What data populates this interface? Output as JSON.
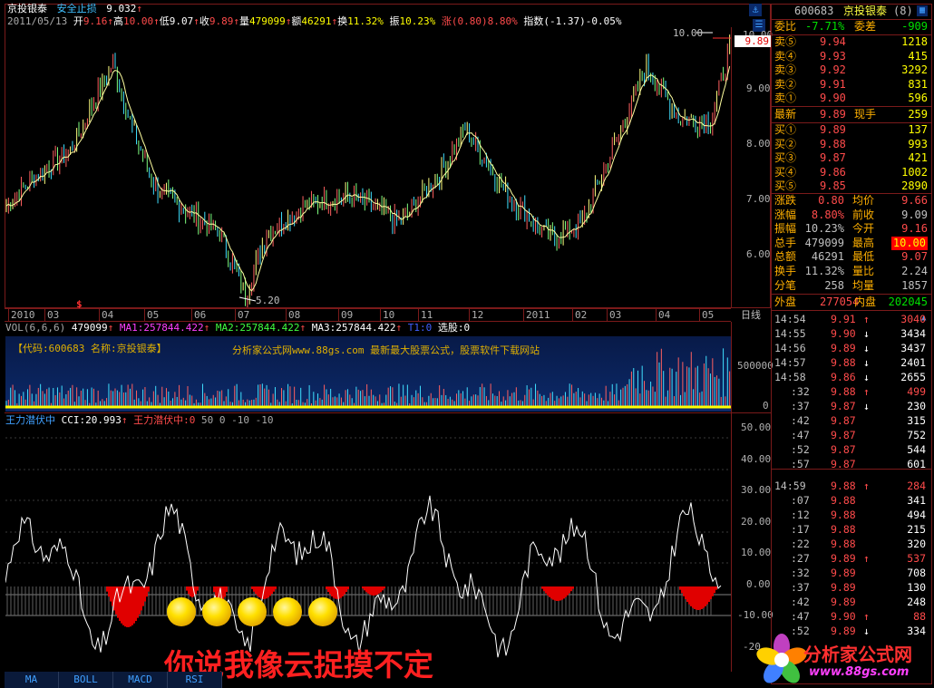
{
  "header": {
    "stock_name": "京投银泰",
    "indicator_name": "安全止损",
    "indicator_value": "9.032",
    "date": "2011/05/13",
    "open_label": "开",
    "open": "9.16",
    "high_label": "高",
    "high": "10.00",
    "low_label": "低",
    "low": "9.07",
    "close_label": "收",
    "close": "9.89",
    "vol_label": "量",
    "volume": "479099",
    "amount_label": "额",
    "amount": "46291",
    "turnover_label": "换",
    "turnover": "11.32%",
    "amplitude_label": "振",
    "amplitude": "10.23%",
    "change_text": "涨(0.80)8.80%",
    "index_text": "指数(-1.37)-0.05%"
  },
  "main_chart": {
    "y_ticks": [
      "10.00",
      "9.00",
      "8.00",
      "7.00",
      "6.00"
    ],
    "high_marker": "10.00",
    "low_marker": "5.20",
    "current_price_tag": "9.89",
    "x_ticks": [
      "2010",
      "03",
      "04",
      "05",
      "06",
      "07",
      "08",
      "09",
      "10",
      "11",
      "12",
      "2011",
      "02",
      "03",
      "04",
      "05"
    ],
    "signal_mark": "$",
    "tab_label": "日线"
  },
  "volume_panel": {
    "params": "VOL(6,6,6)",
    "vol": "479099",
    "ma1": "MA1:257844.422",
    "ma2": "MA2:257844.422",
    "ma3": "MA3:257844.422",
    "t1": "T1:0",
    "pick": "选股:0",
    "banner_code": "【代码:600683 名称:京投银泰】",
    "banner_site": "分析家公式网www.88gs.com 最新最大股票公式，股票软件下载网站",
    "y_ticks": [
      "500000",
      "0"
    ]
  },
  "cci_panel": {
    "name": "王力潜伏中",
    "cci": "CCI:20.993",
    "sub_name": "王力潜伏中:0",
    "levels": "50 0 -10 -10",
    "y_ticks": [
      "50.00",
      "40.00",
      "30.00",
      "20.00",
      "10.00",
      "0.00",
      "-10.00",
      "-20"
    ],
    "caption": "你说我像云捉摸不定"
  },
  "tabs": [
    "MA",
    "BOLL",
    "MACD",
    "RSI"
  ],
  "quote": {
    "code": "600683",
    "name": "京投银泰",
    "badge": "(8)",
    "weibi_label": "委比",
    "weibi": "-7.71%",
    "weicha_label": "委差",
    "weicha": "-909",
    "sells": [
      {
        "label": "卖⑤",
        "price": "9.94",
        "vol": "1218"
      },
      {
        "label": "卖④",
        "price": "9.93",
        "vol": "415"
      },
      {
        "label": "卖③",
        "price": "9.92",
        "vol": "3292"
      },
      {
        "label": "卖②",
        "price": "9.91",
        "vol": "831"
      },
      {
        "label": "卖①",
        "price": "9.90",
        "vol": "596"
      }
    ],
    "latest_label": "最新",
    "latest": "9.89",
    "xianshou_label": "现手",
    "xianshou": "259",
    "buys": [
      {
        "label": "买①",
        "price": "9.89",
        "vol": "137"
      },
      {
        "label": "买②",
        "price": "9.88",
        "vol": "993"
      },
      {
        "label": "买③",
        "price": "9.87",
        "vol": "421"
      },
      {
        "label": "买④",
        "price": "9.86",
        "vol": "1002"
      },
      {
        "label": "买⑤",
        "price": "9.85",
        "vol": "2890"
      }
    ],
    "stats": [
      {
        "l1": "涨跌",
        "v1": "0.80",
        "l2": "均价",
        "v2": "9.66"
      },
      {
        "l1": "涨幅",
        "v1": "8.80%",
        "l2": "前收",
        "v2": "9.09"
      },
      {
        "l1": "振幅",
        "v1": "10.23%",
        "l2": "今开",
        "v2": "9.16"
      },
      {
        "l1": "总手",
        "v1": "479099",
        "l2": "最高",
        "v2": "10.00"
      },
      {
        "l1": "总额",
        "v1": "46291",
        "l2": "最低",
        "v2": "9.07"
      },
      {
        "l1": "换手",
        "v1": "11.32%",
        "l2": "量比",
        "v2": "2.24"
      },
      {
        "l1": "分笔",
        "v1": "258",
        "l2": "均量",
        "v2": "1857"
      }
    ],
    "waipan_label": "外盘",
    "waipan": "277054",
    "neipan_label": "内盘",
    "neipan": "202045"
  },
  "ticks": [
    {
      "t": "14:54",
      "p": "9.91",
      "d": "↑",
      "v": "3040"
    },
    {
      "t": "14:55",
      "p": "9.90",
      "d": "↓",
      "v": "3434"
    },
    {
      "t": "14:56",
      "p": "9.89",
      "d": "↓",
      "v": "3437"
    },
    {
      "t": "14:57",
      "p": "9.88",
      "d": "↓",
      "v": "2401"
    },
    {
      "t": "14:58",
      "p": "9.86",
      "d": "↓",
      "v": "2655"
    },
    {
      "t": ":32",
      "p": "9.88",
      "d": "↑",
      "v": "499"
    },
    {
      "t": ":37",
      "p": "9.87",
      "d": "↓",
      "v": "230"
    },
    {
      "t": ":42",
      "p": "9.87",
      "d": "",
      "v": "315"
    },
    {
      "t": ":47",
      "p": "9.87",
      "d": "",
      "v": "752"
    },
    {
      "t": ":52",
      "p": "9.87",
      "d": "",
      "v": "544"
    },
    {
      "t": ":57",
      "p": "9.87",
      "d": "",
      "v": "601"
    },
    {
      "t": "14:59",
      "p": "9.88",
      "d": "↑",
      "v": "284"
    },
    {
      "t": ":07",
      "p": "9.88",
      "d": "",
      "v": "341"
    },
    {
      "t": ":12",
      "p": "9.88",
      "d": "",
      "v": "494"
    },
    {
      "t": ":17",
      "p": "9.88",
      "d": "",
      "v": "215"
    },
    {
      "t": ":22",
      "p": "9.88",
      "d": "",
      "v": "320"
    },
    {
      "t": ":27",
      "p": "9.89",
      "d": "↑",
      "v": "537"
    },
    {
      "t": ":32",
      "p": "9.89",
      "d": "",
      "v": "708"
    },
    {
      "t": ":37",
      "p": "9.89",
      "d": "",
      "v": "130"
    },
    {
      "t": ":42",
      "p": "9.89",
      "d": "",
      "v": "248"
    },
    {
      "t": ":47",
      "p": "9.90",
      "d": "↑",
      "v": "88"
    },
    {
      "t": ":52",
      "p": "9.89",
      "d": "↓",
      "v": "334"
    }
  ],
  "logo": {
    "title": "分析家公式网",
    "url": "www.88gs.com"
  }
}
